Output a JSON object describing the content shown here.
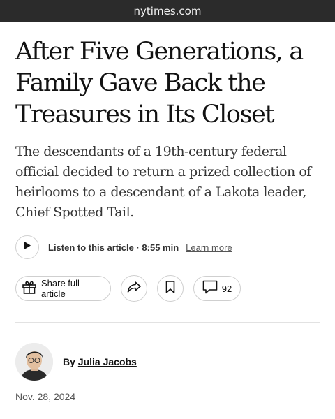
{
  "browser": {
    "url": "nytimes.com"
  },
  "article": {
    "headline": "After Five Generations, a Family Gave Back the Treasures in Its Closet",
    "summary": "The descendants of a 19th-century federal official decided to return a prized collection of heirlooms to a descendant of a Lakota leader, Chief Spotted Tail.",
    "audio": {
      "label": "Listen to this article",
      "separator": "·",
      "duration": "8:55 min",
      "learn_more": "Learn more"
    },
    "actions": {
      "share_full_label": "Share full article",
      "comment_count": "92"
    },
    "byline": {
      "prefix": "By",
      "author": "Julia Jacobs"
    },
    "date": "Nov. 28, 2024"
  },
  "icons": {
    "play": "play-icon",
    "gift": "gift-icon",
    "share": "share-arrow-icon",
    "bookmark": "bookmark-icon",
    "comment": "comment-bubble-icon"
  }
}
